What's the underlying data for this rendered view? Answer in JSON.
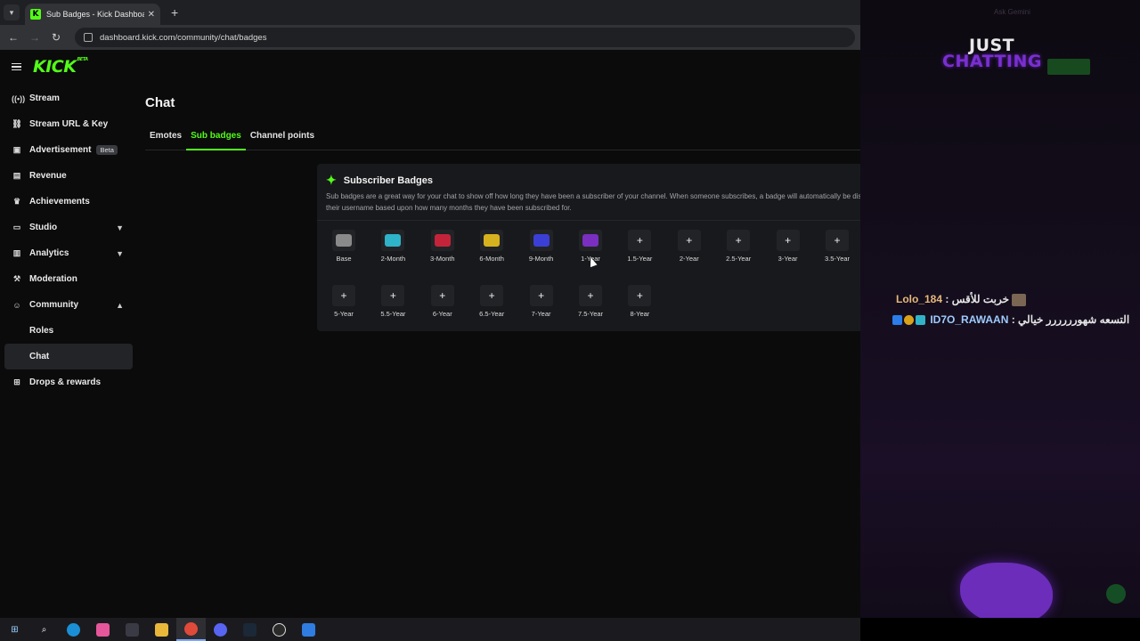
{
  "browser": {
    "tab_title": "Sub Badges - Kick Dashboard",
    "url": "dashboard.kick.com/community/chat/badges"
  },
  "sidebar": {
    "items": [
      {
        "label": "Stream",
        "icon": "broadcast-icon"
      },
      {
        "label": "Stream URL & Key",
        "icon": "link-icon"
      },
      {
        "label": "Advertisement",
        "icon": "megaphone-icon",
        "badge": "Beta"
      },
      {
        "label": "Revenue",
        "icon": "money-icon"
      },
      {
        "label": "Achievements",
        "icon": "trophy-icon"
      },
      {
        "label": "Studio",
        "icon": "monitor-icon",
        "chevron": "down"
      },
      {
        "label": "Analytics",
        "icon": "chart-icon",
        "chevron": "down"
      },
      {
        "label": "Moderation",
        "icon": "hammer-icon"
      },
      {
        "label": "Community",
        "icon": "users-icon",
        "chevron": "up"
      },
      {
        "label": "Roles",
        "sub": true
      },
      {
        "label": "Chat",
        "sub": true,
        "active": true
      },
      {
        "label": "Drops & rewards",
        "icon": "gift-icon"
      }
    ]
  },
  "main": {
    "title": "Chat",
    "tabs": [
      {
        "label": "Emotes",
        "active": false
      },
      {
        "label": "Sub badges",
        "active": true
      },
      {
        "label": "Channel points",
        "active": false
      }
    ],
    "card": {
      "title": "Subscriber Badges",
      "description": "Sub badges are a great way for your chat to show off how long they have been a subscriber of your channel. When someone subscribes, a badge will automatically be displayed next to their username based upon how many months they have been subscribed for.",
      "badges": [
        {
          "label": "Base",
          "filled": true,
          "color": "#8a8a8a"
        },
        {
          "label": "2-Month",
          "filled": true,
          "color": "#2fb3c9"
        },
        {
          "label": "3-Month",
          "filled": true,
          "color": "#c4243a"
        },
        {
          "label": "6-Month",
          "filled": true,
          "color": "#d6b21e"
        },
        {
          "label": "9-Month",
          "filled": true,
          "color": "#3b3fd6"
        },
        {
          "label": "1-Year",
          "filled": true,
          "color": "#7a2fc0"
        },
        {
          "label": "1.5-Year",
          "filled": false
        },
        {
          "label": "2-Year",
          "filled": false
        },
        {
          "label": "2.5-Year",
          "filled": false
        },
        {
          "label": "3-Year",
          "filled": false
        },
        {
          "label": "3.5-Year",
          "filled": false
        },
        {
          "label": "5-Year",
          "filled": false
        },
        {
          "label": "5.5-Year",
          "filled": false
        },
        {
          "label": "6-Year",
          "filled": false
        },
        {
          "label": "6.5-Year",
          "filled": false
        },
        {
          "label": "7-Year",
          "filled": false
        },
        {
          "label": "7.5-Year",
          "filled": false
        },
        {
          "label": "8-Year",
          "filled": false
        }
      ],
      "add_glyph": "+"
    }
  },
  "overlay": {
    "gemini_label": "Ask Gemini",
    "title_line1": "JUST",
    "title_line2": "CHATTING",
    "messages": [
      {
        "user": "Lolo_184",
        "text": "خربت للأقس"
      },
      {
        "user": "ID7O_RAWAAN",
        "text": "التسعه شهورررررر خيالي"
      }
    ]
  },
  "colors": {
    "accent": "#53fc18",
    "card_bg": "#18191c",
    "page_bg": "#0b0b0c"
  }
}
